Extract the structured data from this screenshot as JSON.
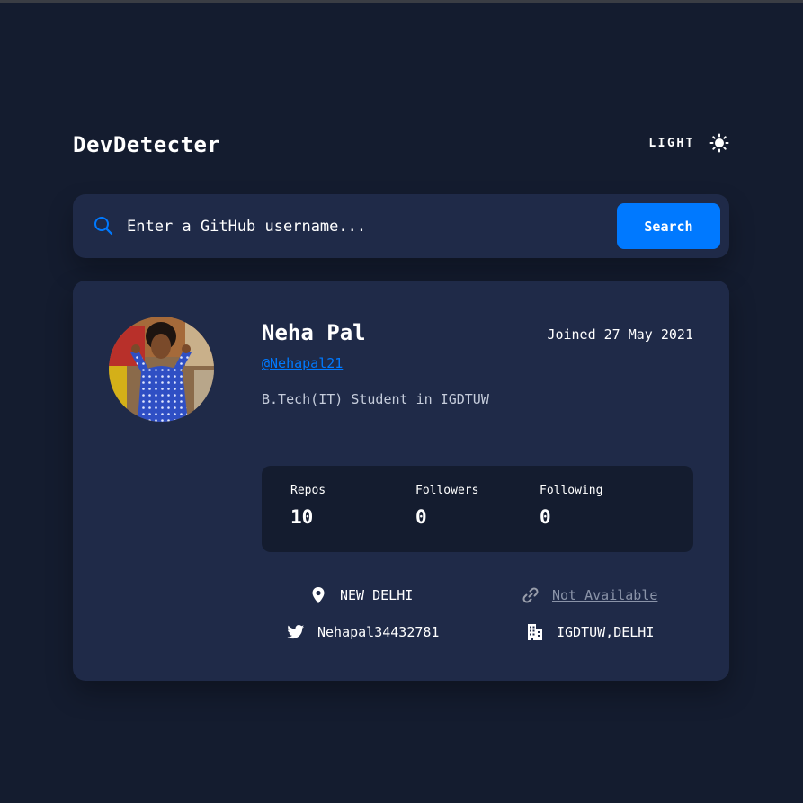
{
  "app": {
    "title": "DevDetecter"
  },
  "theme_toggle": {
    "label": "LIGHT",
    "icon": "sun-icon"
  },
  "search": {
    "placeholder": "Enter a GitHub username...",
    "button_label": "Search",
    "icon": "search-icon"
  },
  "profile": {
    "name": "Neha Pal",
    "joined": "Joined 27 May 2021",
    "handle": "@Nehapal21",
    "bio": "B.Tech(IT) Student in IGDTUW",
    "stats": [
      {
        "label": "Repos",
        "value": "10"
      },
      {
        "label": "Followers",
        "value": "0"
      },
      {
        "label": "Following",
        "value": "0"
      }
    ],
    "location": {
      "value": "NEW DELHI",
      "icon": "location-pin-icon"
    },
    "website": {
      "value": "Not Available",
      "icon": "link-icon"
    },
    "twitter": {
      "value": "Nehapal34432781",
      "icon": "twitter-icon"
    },
    "company": {
      "value": "IGDTUW,DELHI",
      "icon": "building-icon"
    }
  },
  "colors": {
    "background": "#141c2f",
    "card": "#1f2a48",
    "accent": "#0079ff",
    "text": "#ffffff",
    "muted": "#8a93a8"
  }
}
